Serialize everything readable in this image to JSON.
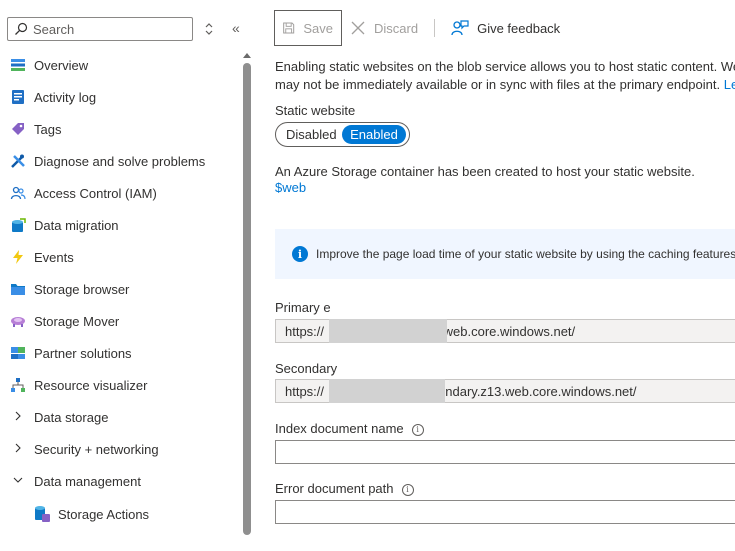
{
  "search": {
    "placeholder": "Search"
  },
  "sidebar": {
    "items": [
      {
        "label": "Overview",
        "icon": "overview-icon"
      },
      {
        "label": "Activity log",
        "icon": "activity-log-icon"
      },
      {
        "label": "Tags",
        "icon": "tag-icon"
      },
      {
        "label": "Diagnose and solve problems",
        "icon": "diagnose-icon"
      },
      {
        "label": "Access Control (IAM)",
        "icon": "iam-icon"
      },
      {
        "label": "Data migration",
        "icon": "data-migration-icon"
      },
      {
        "label": "Events",
        "icon": "lightning-icon"
      },
      {
        "label": "Storage browser",
        "icon": "storage-browser-icon"
      },
      {
        "label": "Storage Mover",
        "icon": "storage-mover-icon"
      },
      {
        "label": "Partner solutions",
        "icon": "partner-solutions-icon"
      },
      {
        "label": "Resource visualizer",
        "icon": "resource-visualizer-icon"
      }
    ],
    "groups": [
      {
        "label": "Data storage",
        "expanded": false
      },
      {
        "label": "Security + networking",
        "expanded": false
      },
      {
        "label": "Data management",
        "expanded": true
      }
    ],
    "sub_items": [
      {
        "label": "Storage Actions",
        "icon": "storage-actions-icon"
      }
    ]
  },
  "toolbar": {
    "save_label": "Save",
    "discard_label": "Discard",
    "feedback_label": "Give feedback"
  },
  "main": {
    "description_line1": "Enabling static websites on the blob service allows you to host static content. We",
    "description_line2": "may not be immediately available or in sync with files at the primary endpoint.",
    "description_link": "Le",
    "static_website_label": "Static website",
    "toggle_off": "Disabled",
    "toggle_on": "Enabled",
    "container_info": "An Azure Storage container has been created to host your static website.",
    "container_link": "$web",
    "banner_text": "Improve the page load time of your static website by using the caching features",
    "primary_label": "Primary e",
    "primary_value_prefix": "https://",
    "primary_value_suffix": ".web.core.windows.net/",
    "secondary_label": "Secondary",
    "secondary_value_prefix": "https://",
    "secondary_value_suffix": "ondary.z13.web.core.windows.net/",
    "index_label": "Index document name",
    "index_value": "",
    "error_label": "Error document path",
    "error_value": ""
  },
  "colors": {
    "accent": "#0078d4",
    "banner_bg": "#f0f6ff"
  }
}
